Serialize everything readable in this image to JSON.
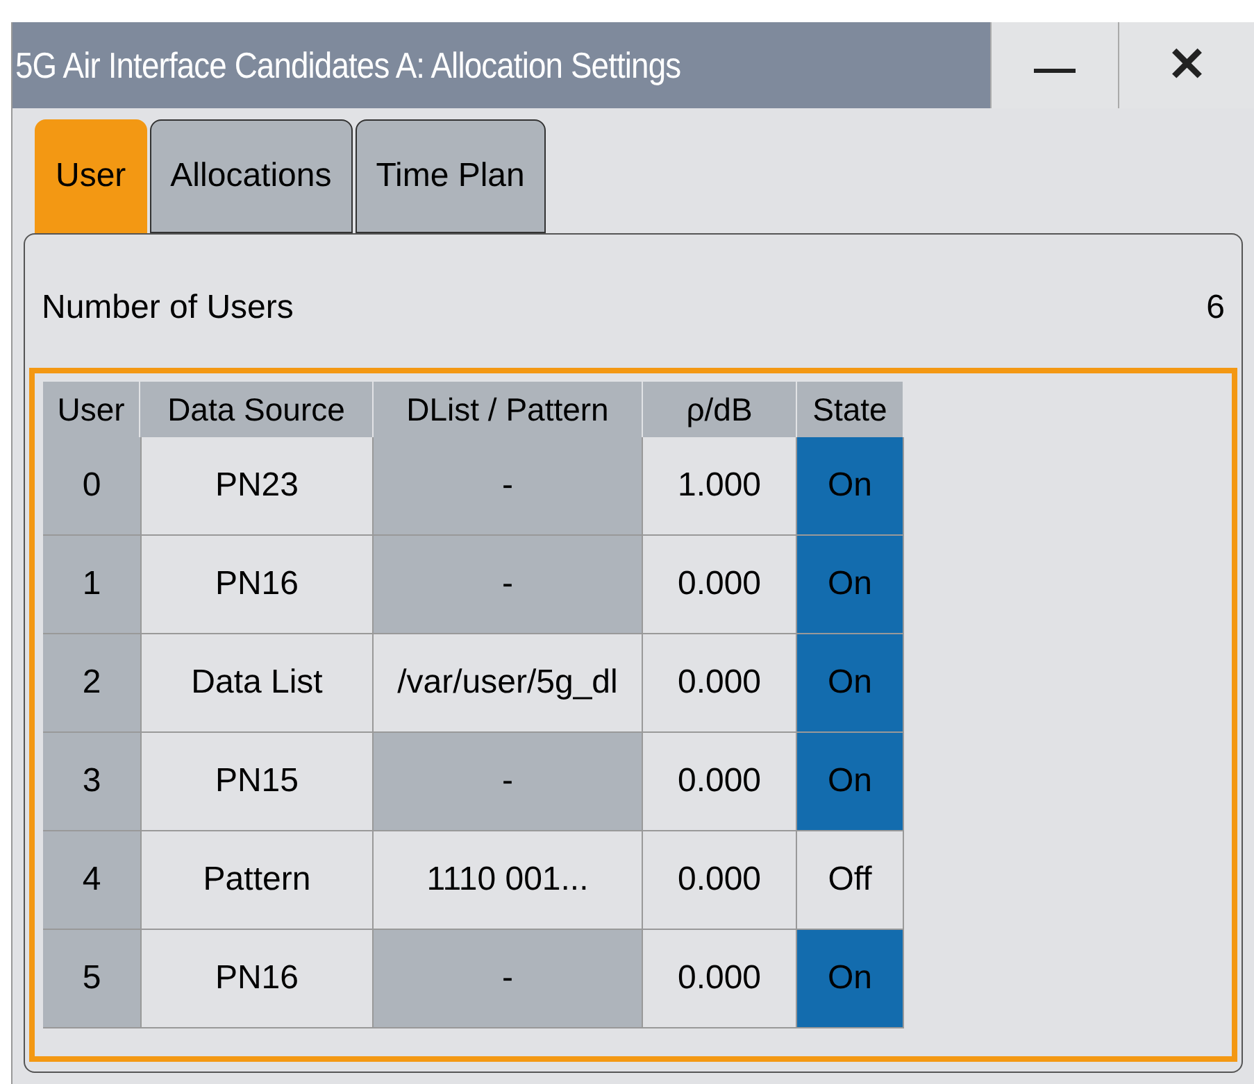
{
  "window": {
    "title": "5G Air Interface Candidates A: Allocation Settings",
    "minimize": "—",
    "close": "✕"
  },
  "tabs": [
    {
      "label": "User",
      "selected": true
    },
    {
      "label": "Allocations",
      "selected": false
    },
    {
      "label": "Time Plan",
      "selected": false
    }
  ],
  "number_of_users": {
    "label": "Number of Users",
    "value": "6"
  },
  "table": {
    "columns": [
      "User",
      "Data Source",
      "DList / Pattern",
      "ρ/dB",
      "State"
    ],
    "rows": [
      {
        "user": "0",
        "data_source": "PN23",
        "pattern": "-",
        "pattern_disabled": true,
        "rho": "1.000",
        "state": "On",
        "on": true
      },
      {
        "user": "1",
        "data_source": "PN16",
        "pattern": "-",
        "pattern_disabled": true,
        "rho": "0.000",
        "state": "On",
        "on": true
      },
      {
        "user": "2",
        "data_source": "Data List",
        "pattern": "/var/user/5g_dl",
        "pattern_disabled": false,
        "rho": "0.000",
        "state": "On",
        "on": true
      },
      {
        "user": "3",
        "data_source": "PN15",
        "pattern": "-",
        "pattern_disabled": true,
        "rho": "0.000",
        "state": "On",
        "on": true
      },
      {
        "user": "4",
        "data_source": "Pattern",
        "pattern": "1110 001...",
        "pattern_disabled": false,
        "rho": "0.000",
        "state": "Off",
        "on": false
      },
      {
        "user": "5",
        "data_source": "PN16",
        "pattern": "-",
        "pattern_disabled": true,
        "rho": "0.000",
        "state": "On",
        "on": true
      }
    ]
  }
}
